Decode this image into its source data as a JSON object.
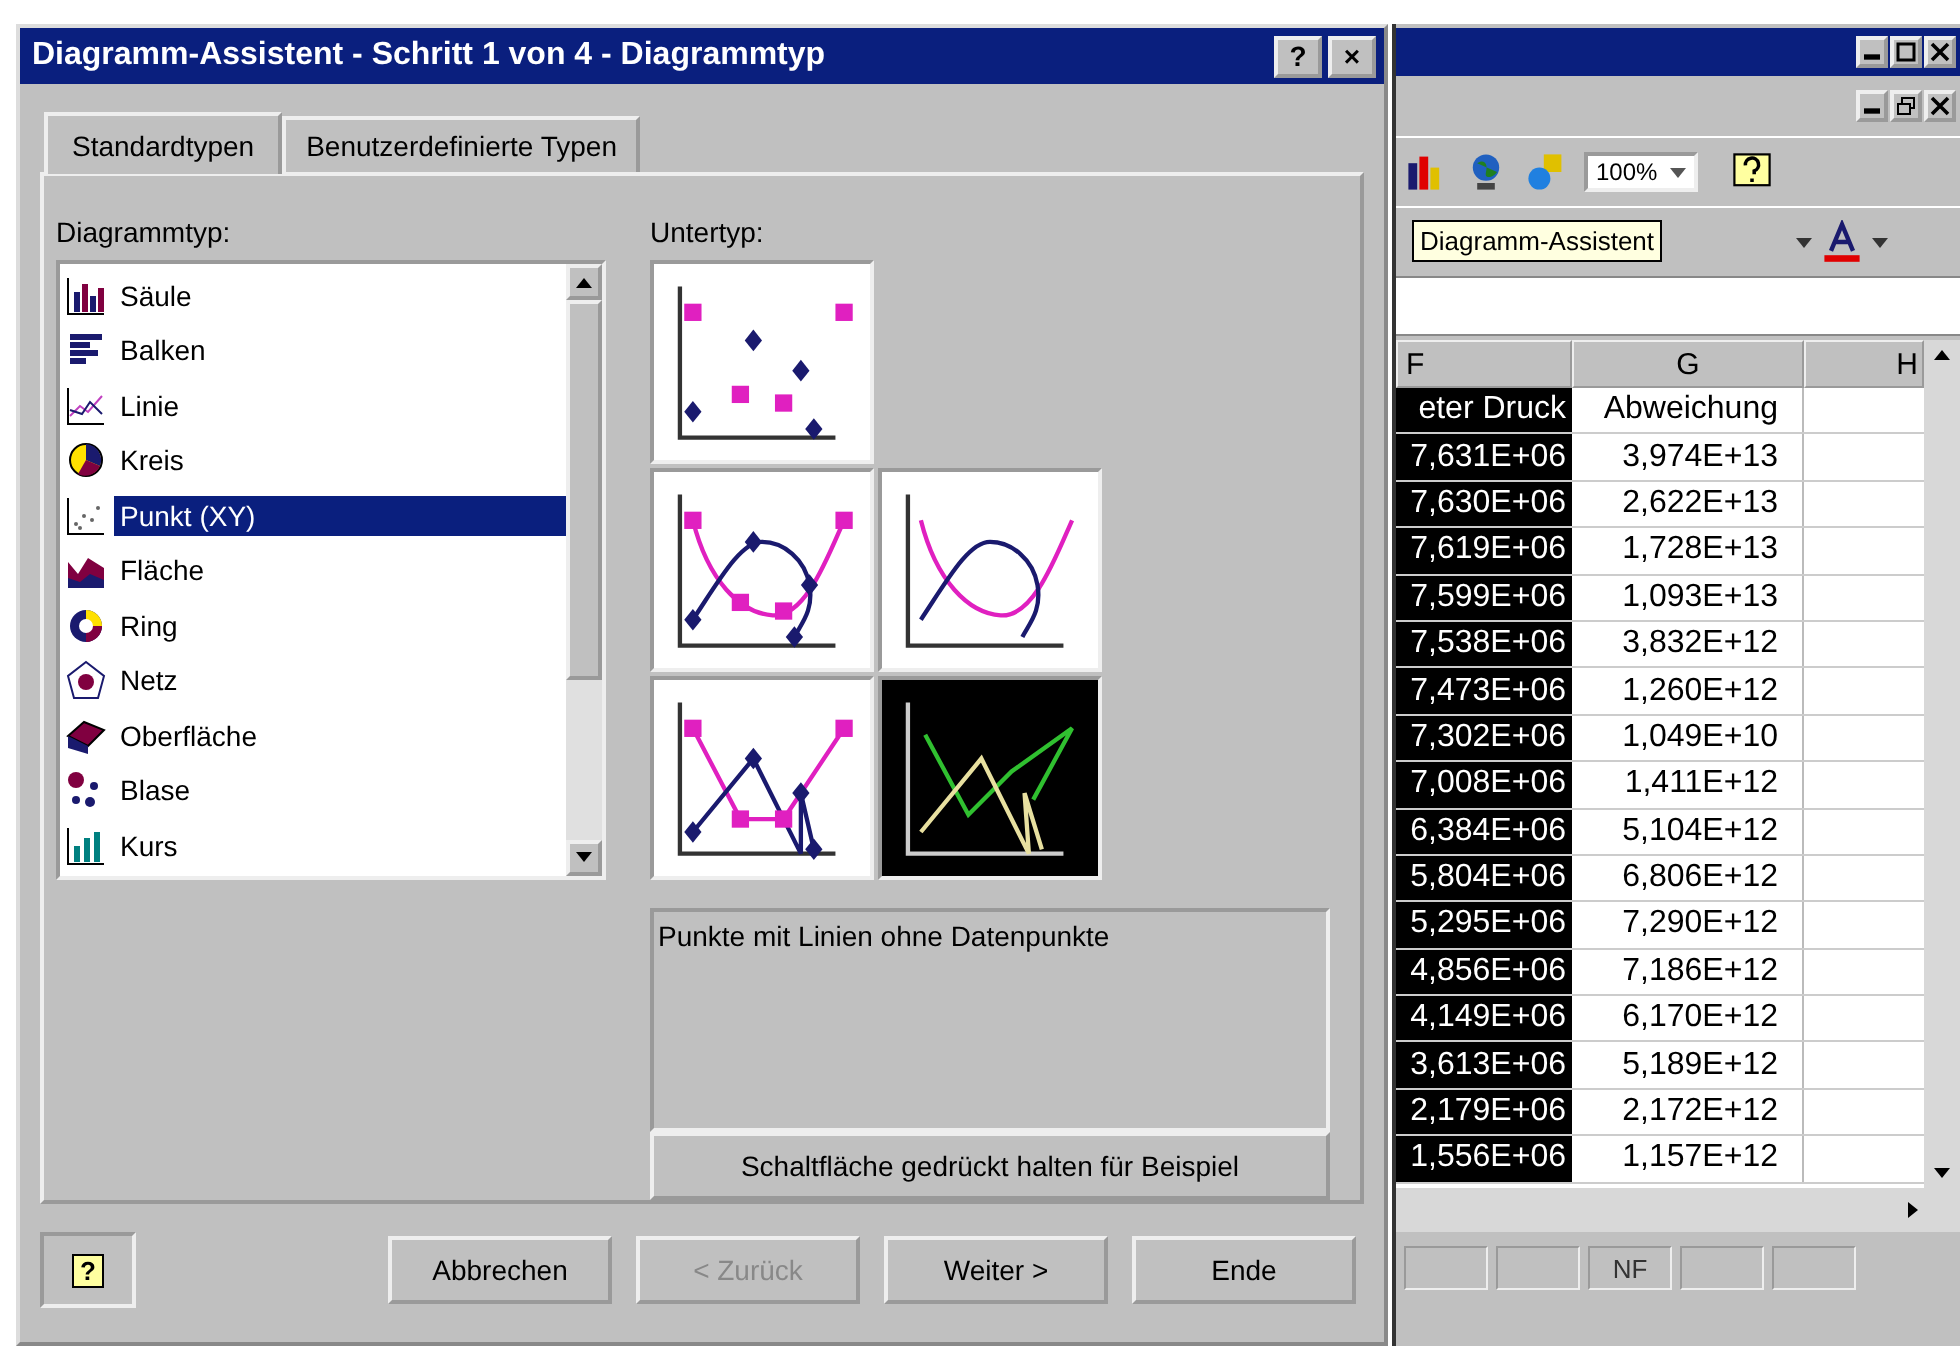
{
  "dialog": {
    "title": "Diagramm-Assistent - Schritt 1 von 4 - Diagrammtyp",
    "title_buttons": [
      "?",
      "×"
    ],
    "tabs": [
      {
        "label": "Standardtypen",
        "selected": true
      },
      {
        "label": "Benutzerdefinierte Typen",
        "selected": false
      }
    ],
    "chart_type_label": "Diagrammtyp:",
    "chart_types": [
      {
        "label": "Säule",
        "selected": false
      },
      {
        "label": "Balken",
        "selected": false
      },
      {
        "label": "Linie",
        "selected": false
      },
      {
        "label": "Kreis",
        "selected": false
      },
      {
        "label": "Punkt (XY)",
        "selected": true
      },
      {
        "label": "Fläche",
        "selected": false
      },
      {
        "label": "Ring",
        "selected": false
      },
      {
        "label": "Netz",
        "selected": false
      },
      {
        "label": "Oberfläche",
        "selected": false
      },
      {
        "label": "Blase",
        "selected": false
      },
      {
        "label": "Kurs",
        "selected": false
      }
    ],
    "subtype_label": "Untertyp:",
    "subtypes": [
      {
        "kind": "markers",
        "selected": false
      },
      {
        "kind": "smooth-markers",
        "selected": false
      },
      {
        "kind": "smooth",
        "selected": false
      },
      {
        "kind": "lines-markers",
        "selected": false
      },
      {
        "kind": "lines",
        "selected": true
      }
    ],
    "description": "Punkte mit Linien ohne Datenpunkte",
    "preview_button": "Schaltfläche gedrückt halten für Beispiel",
    "help_button": "?",
    "buttons": [
      {
        "label": "Abbrechen",
        "disabled": false
      },
      {
        "label": "< Zurück",
        "disabled": true
      },
      {
        "label": "Weiter >",
        "disabled": false
      },
      {
        "label": "Ende",
        "disabled": false
      }
    ]
  },
  "excel": {
    "zoom": "100%",
    "tooltip": "Diagramm-Assistent",
    "columns": [
      "F",
      "G",
      "H"
    ],
    "rows": [
      {
        "f": "eter Druck",
        "g": "Abweichung"
      },
      {
        "f": "7,631E+06",
        "g": "3,974E+13"
      },
      {
        "f": "7,630E+06",
        "g": "2,622E+13"
      },
      {
        "f": "7,619E+06",
        "g": "1,728E+13"
      },
      {
        "f": "7,599E+06",
        "g": "1,093E+13"
      },
      {
        "f": "7,538E+06",
        "g": "3,832E+12"
      },
      {
        "f": "7,473E+06",
        "g": "1,260E+12"
      },
      {
        "f": "7,302E+06",
        "g": "1,049E+10"
      },
      {
        "f": "7,008E+06",
        "g": "1,411E+12"
      },
      {
        "f": "6,384E+06",
        "g": "5,104E+12"
      },
      {
        "f": "5,804E+06",
        "g": "6,806E+12"
      },
      {
        "f": "5,295E+06",
        "g": "7,290E+12"
      },
      {
        "f": "4,856E+06",
        "g": "7,186E+12"
      },
      {
        "f": "4,149E+06",
        "g": "6,170E+12"
      },
      {
        "f": "3,613E+06",
        "g": "5,189E+12"
      },
      {
        "f": "2,179E+06",
        "g": "2,172E+12"
      },
      {
        "f": "1,556E+06",
        "g": "1,157E+12"
      }
    ],
    "status": "NF"
  }
}
